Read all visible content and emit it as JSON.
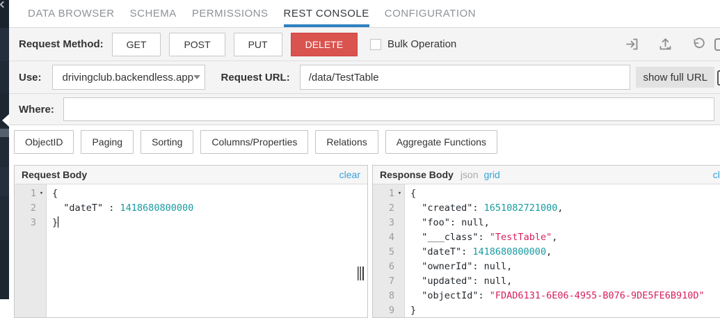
{
  "tabs": {
    "items": [
      {
        "label": "DATA BROWSER",
        "active": false
      },
      {
        "label": "SCHEMA",
        "active": false
      },
      {
        "label": "PERMISSIONS",
        "active": false
      },
      {
        "label": "REST CONSOLE",
        "active": true
      },
      {
        "label": "CONFIGURATION",
        "active": false
      }
    ]
  },
  "toolbar": {
    "request_method_label": "Request Method:",
    "methods": [
      "GET",
      "POST",
      "PUT",
      "DELETE"
    ],
    "selected_method": "DELETE",
    "bulk_operation_label": "Bulk Operation",
    "bulk_operation_checked": false,
    "icons": [
      "sign-in",
      "upload",
      "undo"
    ],
    "use_label": "Use:",
    "use_value": "drivingclub.backendless.app",
    "request_url_label": "Request URL:",
    "request_url_value": "/data/TestTable",
    "show_full_url_label": "show full URL",
    "where_label": "Where:",
    "where_value": ""
  },
  "filters": {
    "buttons": [
      "ObjectID",
      "Paging",
      "Sorting",
      "Columns/Properties",
      "Relations",
      "Aggregate Functions"
    ]
  },
  "request_body": {
    "title": "Request Body",
    "clear_label": "clear",
    "lines": [
      {
        "num": "1",
        "fold": true,
        "tokens": [
          {
            "text": "{",
            "type": "plain"
          }
        ]
      },
      {
        "num": "2",
        "fold": false,
        "tokens": [
          {
            "text": "  \"dateT\" : ",
            "type": "plain"
          },
          {
            "text": "1418680800000",
            "type": "number"
          }
        ]
      },
      {
        "num": "3",
        "fold": false,
        "cursor": true,
        "tokens": [
          {
            "text": "}",
            "type": "plain"
          }
        ]
      }
    ]
  },
  "response_body": {
    "title": "Response Body",
    "view_json_label": "json",
    "view_grid_label": "grid",
    "clear_label": "clear",
    "lines": [
      {
        "num": "1",
        "fold": true,
        "tokens": [
          {
            "text": "{",
            "type": "plain"
          }
        ]
      },
      {
        "num": "2",
        "fold": false,
        "tokens": [
          {
            "text": "  \"created\": ",
            "type": "plain"
          },
          {
            "text": "1651082721000",
            "type": "number"
          },
          {
            "text": ",",
            "type": "plain"
          }
        ]
      },
      {
        "num": "3",
        "fold": false,
        "tokens": [
          {
            "text": "  \"foo\": null,",
            "type": "plain"
          }
        ]
      },
      {
        "num": "4",
        "fold": false,
        "tokens": [
          {
            "text": "  \"___class\": ",
            "type": "plain"
          },
          {
            "text": "\"TestTable\"",
            "type": "string"
          },
          {
            "text": ",",
            "type": "plain"
          }
        ]
      },
      {
        "num": "5",
        "fold": false,
        "tokens": [
          {
            "text": "  \"dateT\": ",
            "type": "plain"
          },
          {
            "text": "1418680800000",
            "type": "number"
          },
          {
            "text": ",",
            "type": "plain"
          }
        ]
      },
      {
        "num": "6",
        "fold": false,
        "tokens": [
          {
            "text": "  \"ownerId\": null,",
            "type": "plain"
          }
        ]
      },
      {
        "num": "7",
        "fold": false,
        "tokens": [
          {
            "text": "  \"updated\": null,",
            "type": "plain"
          }
        ]
      },
      {
        "num": "8",
        "fold": false,
        "tokens": [
          {
            "text": "  \"objectId\": ",
            "type": "plain"
          },
          {
            "text": "\"FDAD6131-6E06-4955-B076-9DE5FE6B910D\"",
            "type": "string"
          }
        ]
      },
      {
        "num": "9",
        "fold": false,
        "tokens": [
          {
            "text": "}",
            "type": "plain"
          }
        ]
      }
    ]
  },
  "colors": {
    "accent_blue": "#2f80c3",
    "link_blue": "#38a1d9",
    "delete_red": "#d9534f",
    "code_number": "#189aa1",
    "code_string": "#d5215c",
    "sidebar_dark": "#202a37"
  }
}
